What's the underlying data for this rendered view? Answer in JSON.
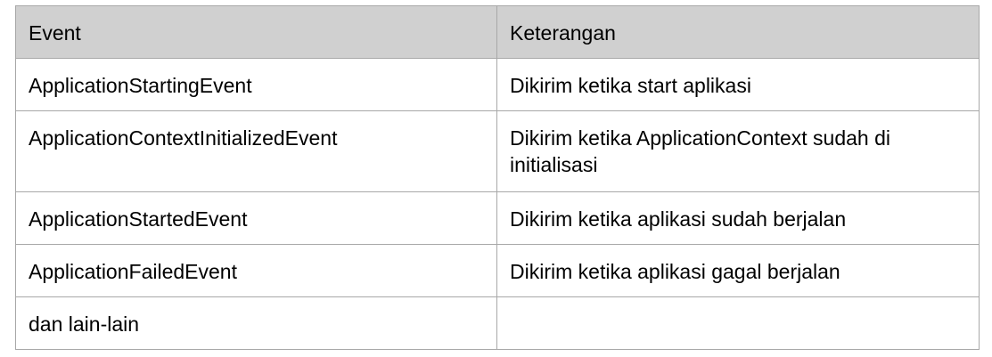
{
  "table": {
    "headers": [
      "Event",
      "Keterangan"
    ],
    "rows": [
      [
        "ApplicationStartingEvent",
        "Dikirim ketika start aplikasi"
      ],
      [
        "ApplicationContextInitializedEvent",
        "Dikirim ketika ApplicationContext sudah di initialisasi"
      ],
      [
        "ApplicationStartedEvent",
        "Dikirim ketika aplikasi sudah berjalan"
      ],
      [
        "ApplicationFailedEvent",
        "Dikirim ketika aplikasi gagal berjalan"
      ],
      [
        "dan lain-lain",
        ""
      ]
    ]
  },
  "colors": {
    "header_background": "#d0d0d0",
    "border": "#a8a8a8",
    "text": "#000000"
  }
}
